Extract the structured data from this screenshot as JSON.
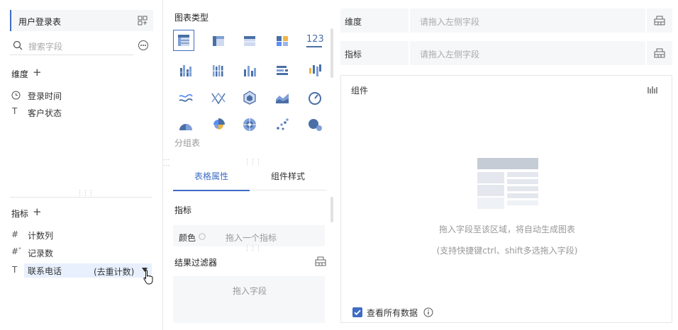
{
  "left_panel": {
    "table_name": "用户登录表",
    "search_placeholder": "搜索字段",
    "dimension_title": "维度",
    "dimensions": [
      {
        "icon": "clock-icon",
        "label": "登录时间"
      },
      {
        "icon": "text-type-icon",
        "label": "客户状态"
      }
    ],
    "metric_title": "指标",
    "metrics": [
      {
        "icon": "hash-icon",
        "label": "计数列"
      },
      {
        "icon": "hash-calc-icon",
        "label": "记录数"
      },
      {
        "icon": "text-type-icon",
        "label": "联系电话",
        "badge": "(去重计数)"
      }
    ]
  },
  "middle_panel": {
    "chart_type_title": "图表类型",
    "chart_types": [
      "table-icon",
      "cross-table-icon",
      "detail-table-icon",
      "color-block-icon",
      "kpi-number-icon",
      "grouped-bar-icon",
      "stacked-bar-icon",
      "column-icon",
      "horizontal-bar-icon",
      "range-column-icon",
      "line-icon",
      "radar-line-icon",
      "polygon-icon",
      "area-icon",
      "gauge-icon",
      "semi-pie-icon",
      "rose-pie-icon",
      "sunburst-icon",
      "scatter-icon",
      "bubble-icon"
    ],
    "kpi_label": "123",
    "chart_type_group": "分组表",
    "tabs": [
      "表格属性",
      "组件样式"
    ],
    "active_tab": 0,
    "metric_section_title": "指标",
    "color_label": "颜色",
    "color_drop_hint": "拖入一个指标",
    "filter_title": "结果过滤器",
    "filter_drop_hint": "拖入字段"
  },
  "right_panel": {
    "dimension_row": {
      "name": "维度",
      "placeholder": "请拖入左侧字段"
    },
    "metric_row": {
      "name": "指标",
      "placeholder": "请拖入左侧字段"
    },
    "component_title": "组件",
    "empty_hint": "拖入字段至该区域，将自动生成图表",
    "empty_sub_hint": "(支持快捷键ctrl、shift多选拖入字段)",
    "view_all_label": "查看所有数据",
    "view_all_checked": true
  },
  "colors": {
    "accent": "#3f6cc4",
    "chart_blue": "#5b8ff9",
    "chart_dark": "#4a6fa5",
    "panel_bg": "#f6f7f9"
  }
}
